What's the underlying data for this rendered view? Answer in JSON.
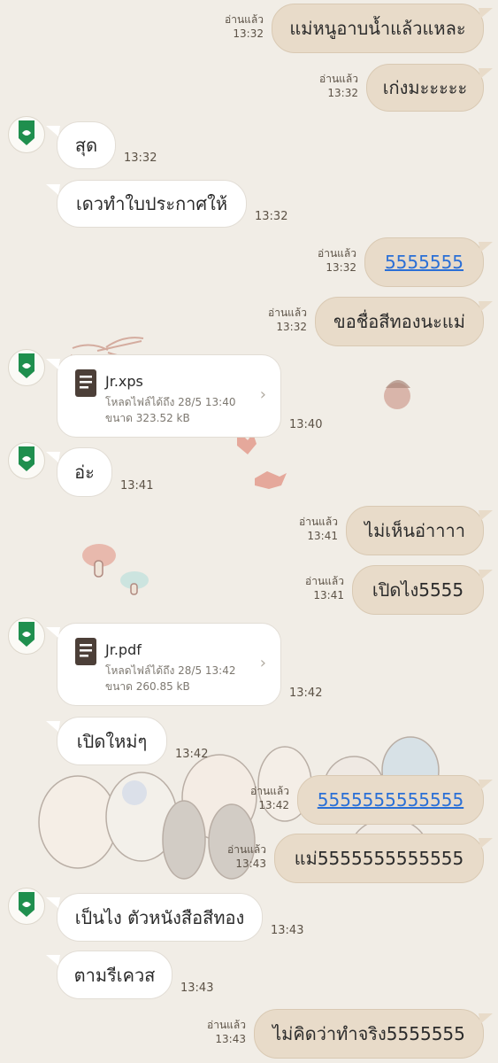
{
  "read_label": "อ่านแล้ว",
  "messages": [
    {
      "dir": "out",
      "text": "แม่หนูอาบน้ำแล้วแหละ",
      "time": "13:32"
    },
    {
      "dir": "out",
      "text": "เก่งมะะะะะ",
      "time": "13:32"
    },
    {
      "dir": "in",
      "text": "สุด",
      "time": "13:32"
    },
    {
      "dir": "in",
      "text": "เดวทำใบประกาศให้",
      "time": "13:32"
    },
    {
      "dir": "out",
      "text": "5555555",
      "time": "13:32"
    },
    {
      "dir": "out",
      "text": "ขอชื่อสีทองนะแม่",
      "time": "13:32"
    },
    {
      "dir": "in",
      "type": "file",
      "file_name": "Jr.xps",
      "expiry": "โหลดไฟล์ได้ถึง 28/5 13:40",
      "size": "ขนาด 323.52 kB",
      "time": "13:40"
    },
    {
      "dir": "in",
      "text": "อ่ะ",
      "time": "13:41"
    },
    {
      "dir": "out",
      "text": "ไม่เห็นอ่าาาา",
      "time": "13:41"
    },
    {
      "dir": "out",
      "text": "เปิดไง5555",
      "time": "13:41"
    },
    {
      "dir": "in",
      "type": "file",
      "file_name": "Jr.pdf",
      "expiry": "โหลดไฟล์ได้ถึง 28/5 13:42",
      "size": "ขนาด 260.85 kB",
      "time": "13:42"
    },
    {
      "dir": "in",
      "text": "เปิดใหม่ๆ",
      "time": "13:42"
    },
    {
      "dir": "out",
      "text": "5555555555555",
      "time": "13:42"
    },
    {
      "dir": "out",
      "text": "แม่5555555555555",
      "time": "13:43"
    },
    {
      "dir": "in",
      "text": "เป็นไง ตัวหนังสือสีทอง",
      "time": "13:43"
    },
    {
      "dir": "in",
      "text": "ตามรีเควส",
      "time": "13:43"
    },
    {
      "dir": "out",
      "text": "ไม่คิดว่าทำจริง5555555",
      "time": "13:43"
    }
  ],
  "colors": {
    "background": "#f1ede6",
    "outgoing": "#e8dbc9",
    "incoming": "#ffffff",
    "link": "#2a6fd6",
    "avatar_green": "#1f8f4e"
  }
}
